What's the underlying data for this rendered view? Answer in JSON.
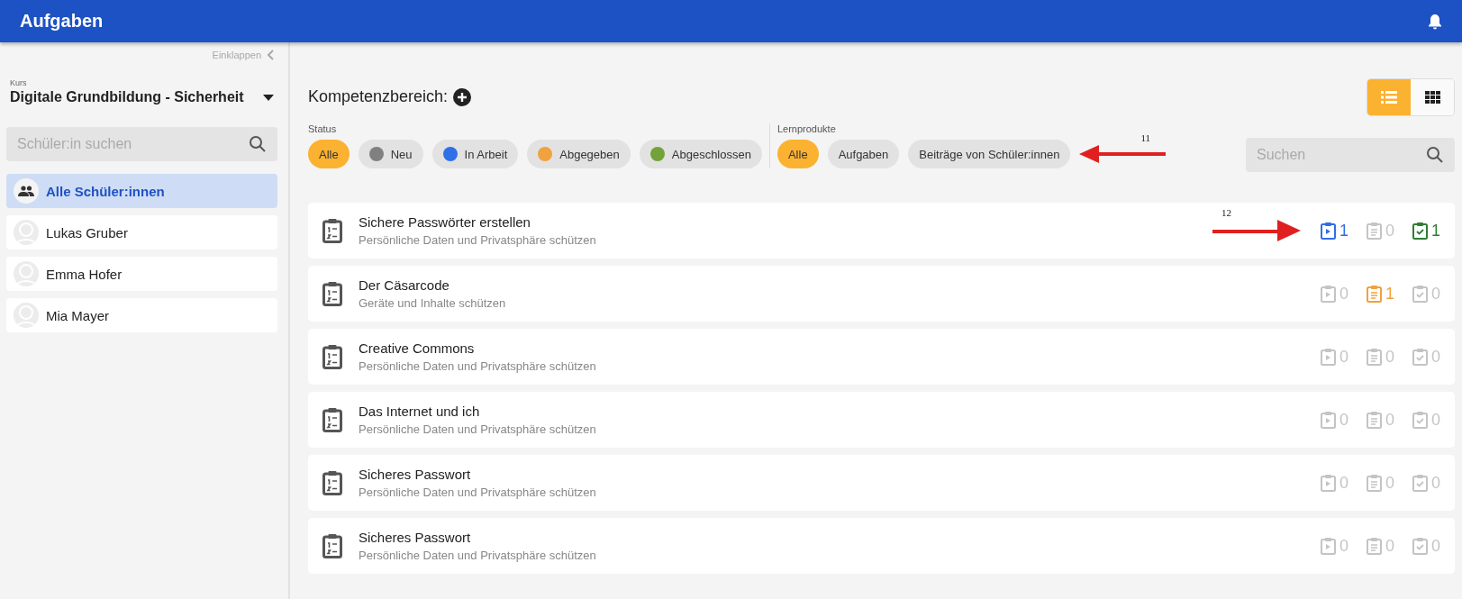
{
  "header": {
    "title": "Aufgaben"
  },
  "sidebar": {
    "collapse_label": "Einklappen",
    "course_label": "Kurs",
    "course": "Digitale Grundbildung - Sicherheit",
    "search": {
      "placeholder": "Schüler:in suchen"
    },
    "students": [
      {
        "name": "Alle Schüler:innen",
        "kind": "group",
        "selected": true
      },
      {
        "name": "Lukas Gruber",
        "kind": "person",
        "selected": false
      },
      {
        "name": "Emma Hofer",
        "kind": "person",
        "selected": false
      },
      {
        "name": "Mia Mayer",
        "kind": "person",
        "selected": false
      }
    ]
  },
  "main": {
    "competence_label": "Kompetenzbereich:",
    "view_toggle": [
      {
        "kind": "list",
        "selected": true
      },
      {
        "kind": "grid",
        "selected": false
      }
    ],
    "status_filter": {
      "label": "Status",
      "chips": [
        {
          "label": "Alle",
          "selected": true
        },
        {
          "label": "Neu",
          "selected": false,
          "color": "#808080"
        },
        {
          "label": "In Arbeit",
          "selected": false,
          "color": "#2f6fe8"
        },
        {
          "label": "Abgegeben",
          "selected": false,
          "color": "#f0a23e"
        },
        {
          "label": "Abgeschlossen",
          "selected": false,
          "color": "#72a33a"
        }
      ]
    },
    "product_filter": {
      "label": "Lernprodukte",
      "chips": [
        {
          "label": "Alle",
          "selected": true
        },
        {
          "label": "Aufgaben",
          "selected": false
        },
        {
          "label": "Beiträge von Schüler:innen",
          "selected": false
        }
      ],
      "annotation": "11"
    },
    "search": {
      "placeholder": "Suchen"
    },
    "tasks": [
      {
        "title": "Sichere Passwörter erstellen",
        "subtitle": "Persönliche Daten und Privatsphäre schützen",
        "annotation": "12",
        "counters": [
          {
            "kind": "in_progress",
            "count": "1",
            "active": true
          },
          {
            "kind": "submitted",
            "count": "0",
            "active": false
          },
          {
            "kind": "done",
            "count": "1",
            "active": true
          }
        ]
      },
      {
        "title": "Der Cäsarcode",
        "subtitle": "Geräte und Inhalte schützen",
        "counters": [
          {
            "kind": "in_progress",
            "count": "0",
            "active": false
          },
          {
            "kind": "submitted",
            "count": "1",
            "active": true
          },
          {
            "kind": "done",
            "count": "0",
            "active": false
          }
        ]
      },
      {
        "title": "Creative Commons",
        "subtitle": "Persönliche Daten und Privatsphäre schützen",
        "counters": [
          {
            "kind": "in_progress",
            "count": "0",
            "active": false
          },
          {
            "kind": "submitted",
            "count": "0",
            "active": false
          },
          {
            "kind": "done",
            "count": "0",
            "active": false
          }
        ]
      },
      {
        "title": "Das Internet und ich",
        "subtitle": "Persönliche Daten und Privatsphäre schützen",
        "counters": [
          {
            "kind": "in_progress",
            "count": "0",
            "active": false
          },
          {
            "kind": "submitted",
            "count": "0",
            "active": false
          },
          {
            "kind": "done",
            "count": "0",
            "active": false
          }
        ]
      },
      {
        "title": "Sicheres Passwort",
        "subtitle": "Persönliche Daten und Privatsphäre schützen",
        "counters": [
          {
            "kind": "in_progress",
            "count": "0",
            "active": false
          },
          {
            "kind": "submitted",
            "count": "0",
            "active": false
          },
          {
            "kind": "done",
            "count": "0",
            "active": false
          }
        ]
      },
      {
        "title": "Sicheres Passwort",
        "subtitle": "Persönliche Daten und Privatsphäre schützen",
        "counters": [
          {
            "kind": "in_progress",
            "count": "0",
            "active": false
          },
          {
            "kind": "submitted",
            "count": "0",
            "active": false
          },
          {
            "kind": "done",
            "count": "0",
            "active": false
          }
        ]
      }
    ]
  }
}
